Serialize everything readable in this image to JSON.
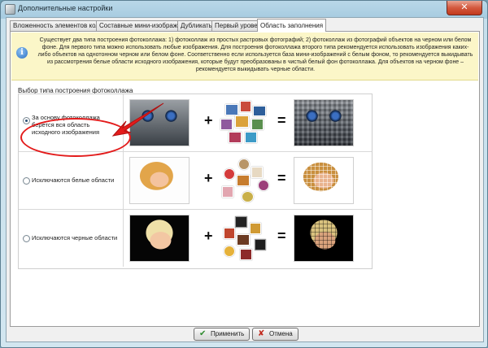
{
  "window": {
    "title": "Дополнительные настройки",
    "close_glyph": "✕"
  },
  "tabs": [
    {
      "label": "Вложенность элементов коллажа",
      "active": false
    },
    {
      "label": "Составные мини-изображения",
      "active": false
    },
    {
      "label": "Дубликаты",
      "active": false
    },
    {
      "label": "Первый уровень",
      "active": false
    },
    {
      "label": "Область заполнения",
      "active": true
    }
  ],
  "info": {
    "icon": "info-icon",
    "text": "Существует два типа построения фотоколлажа: 1) фотоколлаж из простых растровых фотографий; 2) фотоколлаж из фотографий объектов на черном или белом фоне. Для первого типа можно использовать любые изображения. Для построения фотоколлажа второго типа рекомендуется использовать изображения каких-либо объектов на однотонном черном или белом фоне. Соответственно если используется база мини-изображений с белым фоном, то рекомендуется выкидывать из рассмотрения белые области исходного изображения, которые будут преобразованы в чистый белый фон фотоколлажа. Для объектов на черном фоне – рекомендуется выкидывать черные области."
  },
  "group_label": "Выбор типа построения фотоколлажа",
  "options": [
    {
      "label": "За основу фотоколлажа берется вся область исходного изображения",
      "selected": true
    },
    {
      "label": "Исключаются белые области",
      "selected": false
    },
    {
      "label": "Исключаются черные области",
      "selected": false
    }
  ],
  "symbols": {
    "plus": "+",
    "equals": "="
  },
  "buttons": {
    "apply": "Применить",
    "cancel": "Отмена"
  },
  "colors": {
    "accent_annotation": "#e31b1b",
    "info_background": "#fbf6c8",
    "titlebar": "#b9d8e8"
  }
}
